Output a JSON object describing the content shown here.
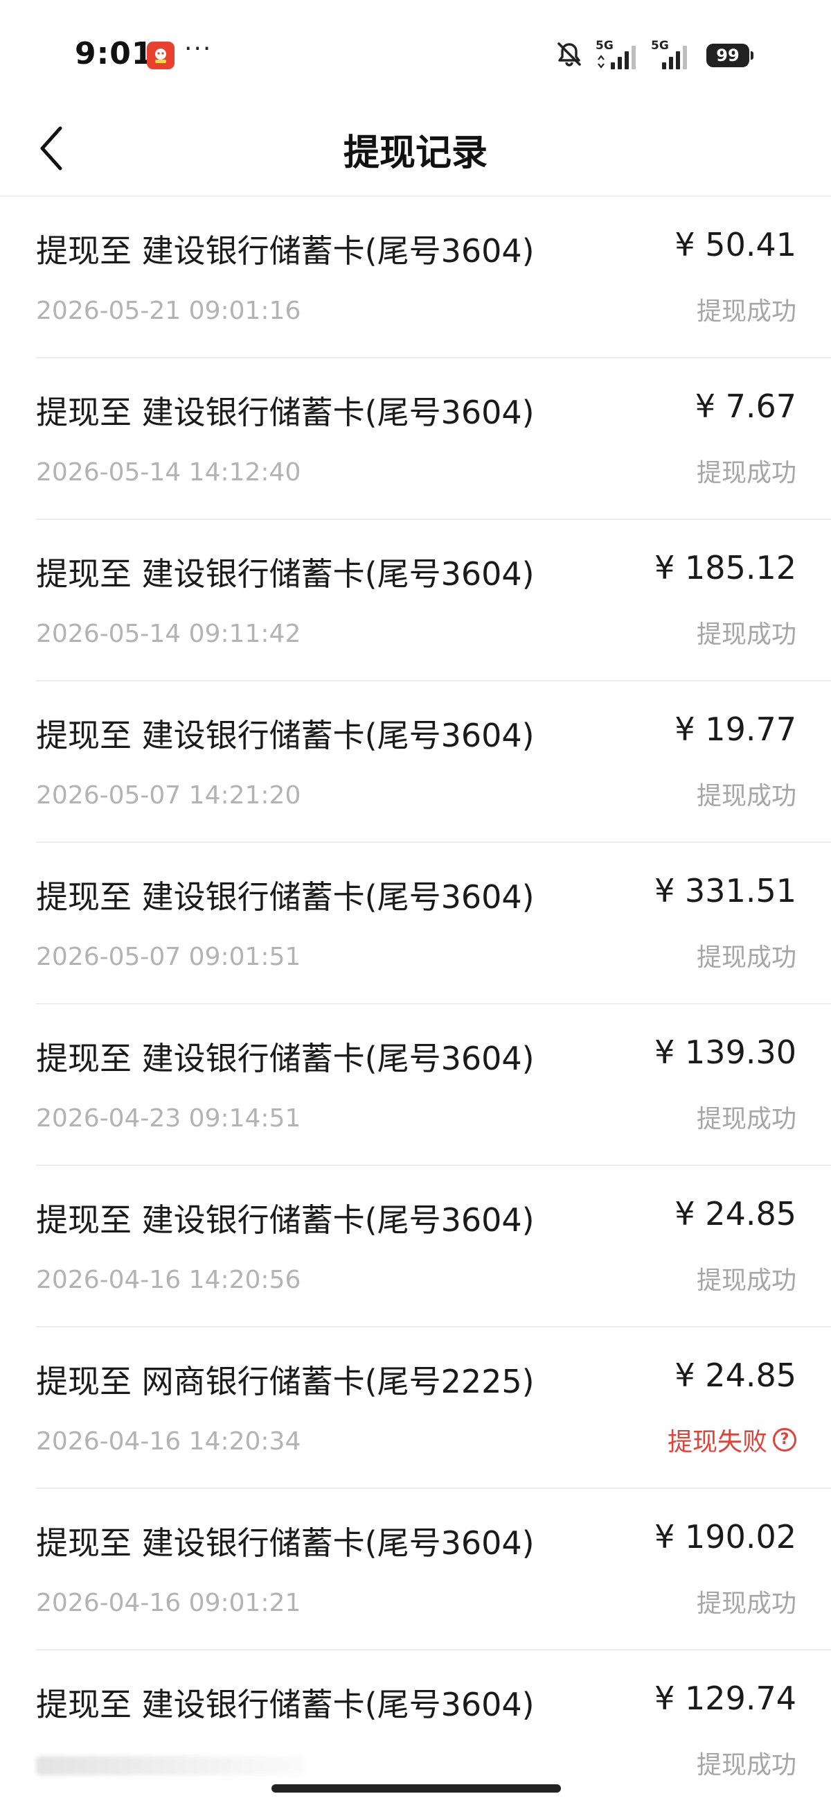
{
  "status_bar": {
    "time": "9:01",
    "more": "···",
    "signal_label_1": "5G",
    "signal_label_2": "5G",
    "battery": "99"
  },
  "header": {
    "title": "提现记录"
  },
  "records": [
    {
      "title": "提现至 建设银行储蓄卡(尾号3604)",
      "date": "2026-05-21 09:01:16",
      "amount": "¥ 50.41",
      "status": "提现成功"
    },
    {
      "title": "提现至 建设银行储蓄卡(尾号3604)",
      "date": "2026-05-14 14:12:40",
      "amount": "¥ 7.67",
      "status": "提现成功"
    },
    {
      "title": "提现至 建设银行储蓄卡(尾号3604)",
      "date": "2026-05-14 09:11:42",
      "amount": "¥ 185.12",
      "status": "提现成功"
    },
    {
      "title": "提现至 建设银行储蓄卡(尾号3604)",
      "date": "2026-05-07 14:21:20",
      "amount": "¥ 19.77",
      "status": "提现成功"
    },
    {
      "title": "提现至 建设银行储蓄卡(尾号3604)",
      "date": "2026-05-07 09:01:51",
      "amount": "¥ 331.51",
      "status": "提现成功"
    },
    {
      "title": "提现至 建设银行储蓄卡(尾号3604)",
      "date": "2026-04-23 09:14:51",
      "amount": "¥ 139.30",
      "status": "提现成功"
    },
    {
      "title": "提现至 建设银行储蓄卡(尾号3604)",
      "date": "2026-04-16 14:20:56",
      "amount": "¥ 24.85",
      "status": "提现成功"
    },
    {
      "title": "提现至 网商银行储蓄卡(尾号2225)",
      "date": "2026-04-16 14:20:34",
      "amount": "¥ 24.85",
      "status": "提现失败",
      "failed": true
    },
    {
      "title": "提现至 建设银行储蓄卡(尾号3604)",
      "date": "2026-04-16 09:01:21",
      "amount": "¥ 190.02",
      "status": "提现成功"
    },
    {
      "title": "提现至 建设银行储蓄卡(尾号3604)",
      "date": "",
      "amount": "¥ 129.74",
      "status": "提现成功"
    }
  ],
  "icons": {
    "back": "chevron-left-icon",
    "app": "app-notification-icon",
    "mute": "bell-muted-icon",
    "signal": "cellular-signal-icon",
    "help": "question-circle-icon"
  },
  "colors": {
    "text_primary": "#1a1a1a",
    "text_secondary": "#b3b3b3",
    "status_success": "#a6a6a6",
    "status_failed": "#e0423a",
    "divider": "#ededed"
  }
}
